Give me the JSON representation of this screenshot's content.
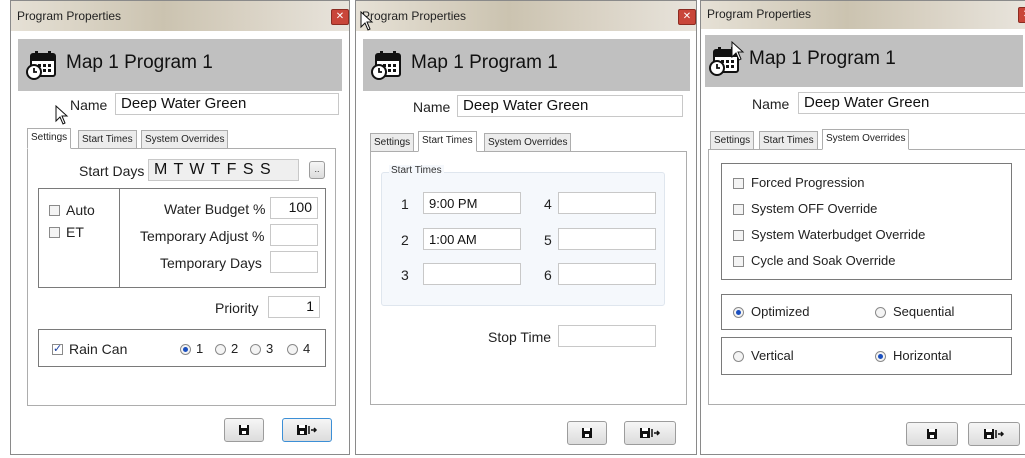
{
  "panel_settings": {
    "window_title": "Program Properties",
    "program_title": "Map 1 Program 1",
    "name_label": "Name",
    "name_value": "Deep Water Green",
    "tabs": [
      "Settings",
      "Start Times",
      "System Overrides"
    ],
    "active_tab": "Settings",
    "start_days_label": "Start Days",
    "start_days_value": "M T W T F S S",
    "ellipsis_label": "..",
    "auto_label": "Auto",
    "et_label": "ET",
    "water_budget_label": "Water Budget %",
    "water_budget_value": "100",
    "temp_adjust_label": "Temporary Adjust %",
    "temp_adjust_value": "",
    "temp_days_label": "Temporary Days",
    "temp_days_value": "",
    "priority_label": "Priority",
    "priority_value": "1",
    "rain_can_label": "Rain Can",
    "rain_can_checked": true,
    "rain_options": [
      "1",
      "2",
      "3",
      "4"
    ],
    "rain_selected": "1"
  },
  "panel_start_times": {
    "window_title": "Program Properties",
    "program_title": "Map 1 Program 1",
    "name_label": "Name",
    "name_value": "Deep Water Green",
    "tabs": [
      "Settings",
      "Start Times",
      "System Overrides"
    ],
    "active_tab": "Start Times",
    "start_times_legend": "Start Times",
    "start_times": [
      {
        "index": "1",
        "value": "9:00 PM"
      },
      {
        "index": "2",
        "value": "1:00 AM"
      },
      {
        "index": "3",
        "value": ""
      },
      {
        "index": "4",
        "value": ""
      },
      {
        "index": "5",
        "value": ""
      },
      {
        "index": "6",
        "value": ""
      }
    ],
    "stop_time_label": "Stop Time",
    "stop_time_value": ""
  },
  "panel_overrides": {
    "window_title": "Program Properties",
    "program_title": "Map 1 Program 1",
    "name_label": "Name",
    "name_value": "Deep Water Green",
    "tabs": [
      "Settings",
      "Start Times",
      "System Overrides"
    ],
    "active_tab": "System Overrides",
    "overrides": [
      {
        "label": "Forced Progression",
        "checked": false
      },
      {
        "label": "System OFF Override",
        "checked": false
      },
      {
        "label": "System Waterbudget Override",
        "checked": false
      },
      {
        "label": "Cycle and Soak Override",
        "checked": false
      }
    ],
    "mode_optimized": "Optimized",
    "mode_sequential": "Sequential",
    "mode_selected": "Optimized",
    "orient_vertical": "Vertical",
    "orient_horizontal": "Horizontal",
    "orient_selected": "Horizontal"
  },
  "footer": {
    "save_icon": "save-icon",
    "save_exit_icon": "save-exit-icon"
  },
  "colors": {
    "header_band": "#c0c0c0",
    "close_button": "#c9463a",
    "default_button_border": "#3c8fd6",
    "radio_dot": "#1a4fbf"
  }
}
